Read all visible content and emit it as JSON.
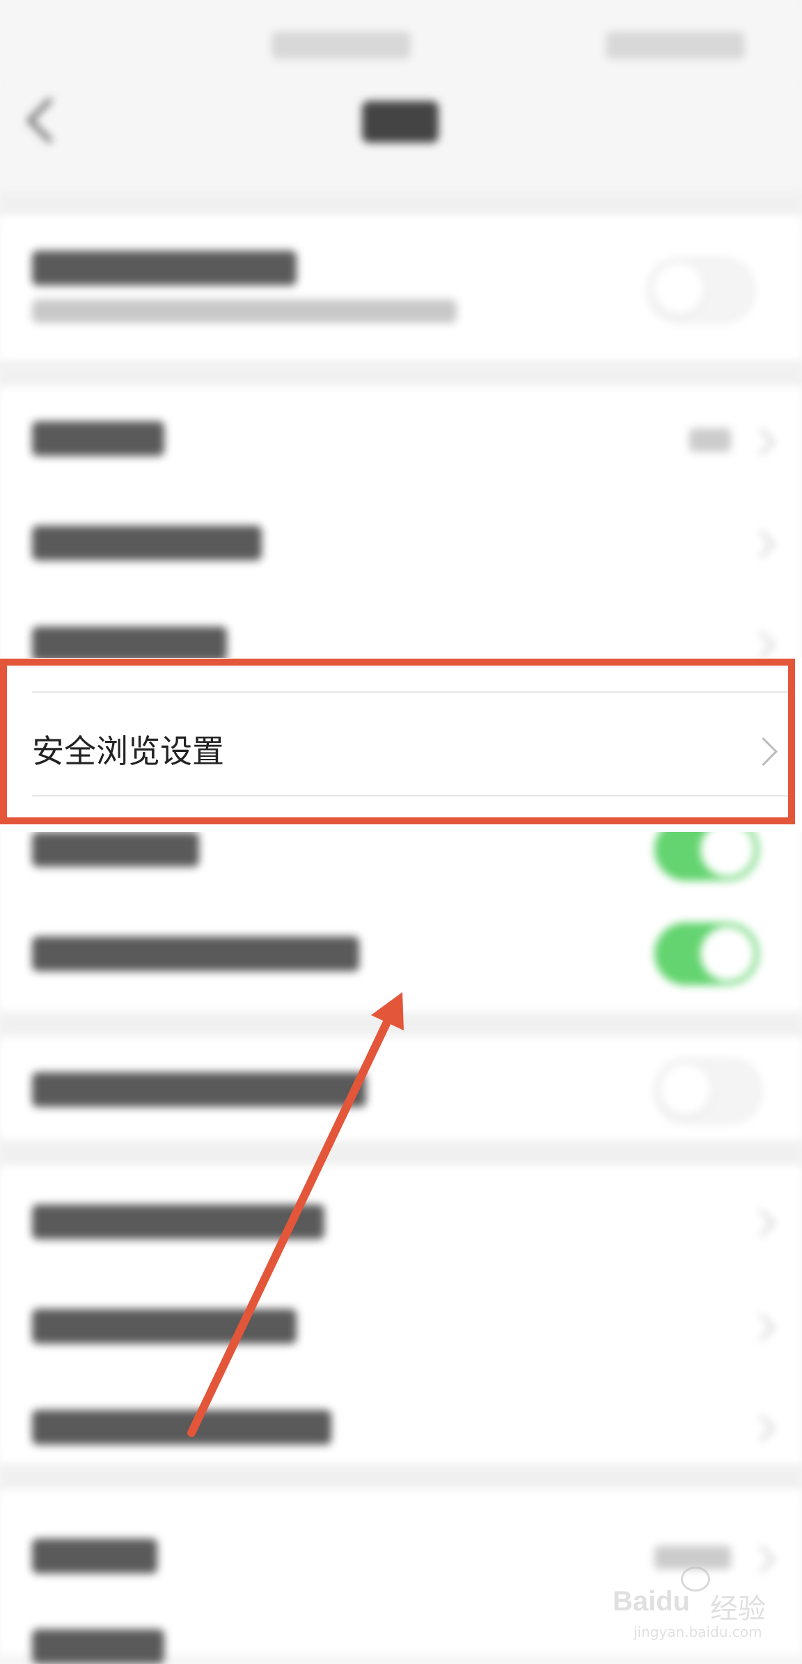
{
  "status_bar": {
    "center_text": "",
    "right_text": ""
  },
  "header": {
    "title": "设置"
  },
  "highlighted_row": {
    "label": "安全浏览设置"
  },
  "annotation": {
    "box_color": "#e4563a",
    "arrow_color": "#e4563a"
  },
  "toggles": {
    "on_color": "#63d46f"
  },
  "watermark": {
    "brand": "Baidu",
    "brand_cn": "经验",
    "url": "jingyan.baidu.com"
  }
}
